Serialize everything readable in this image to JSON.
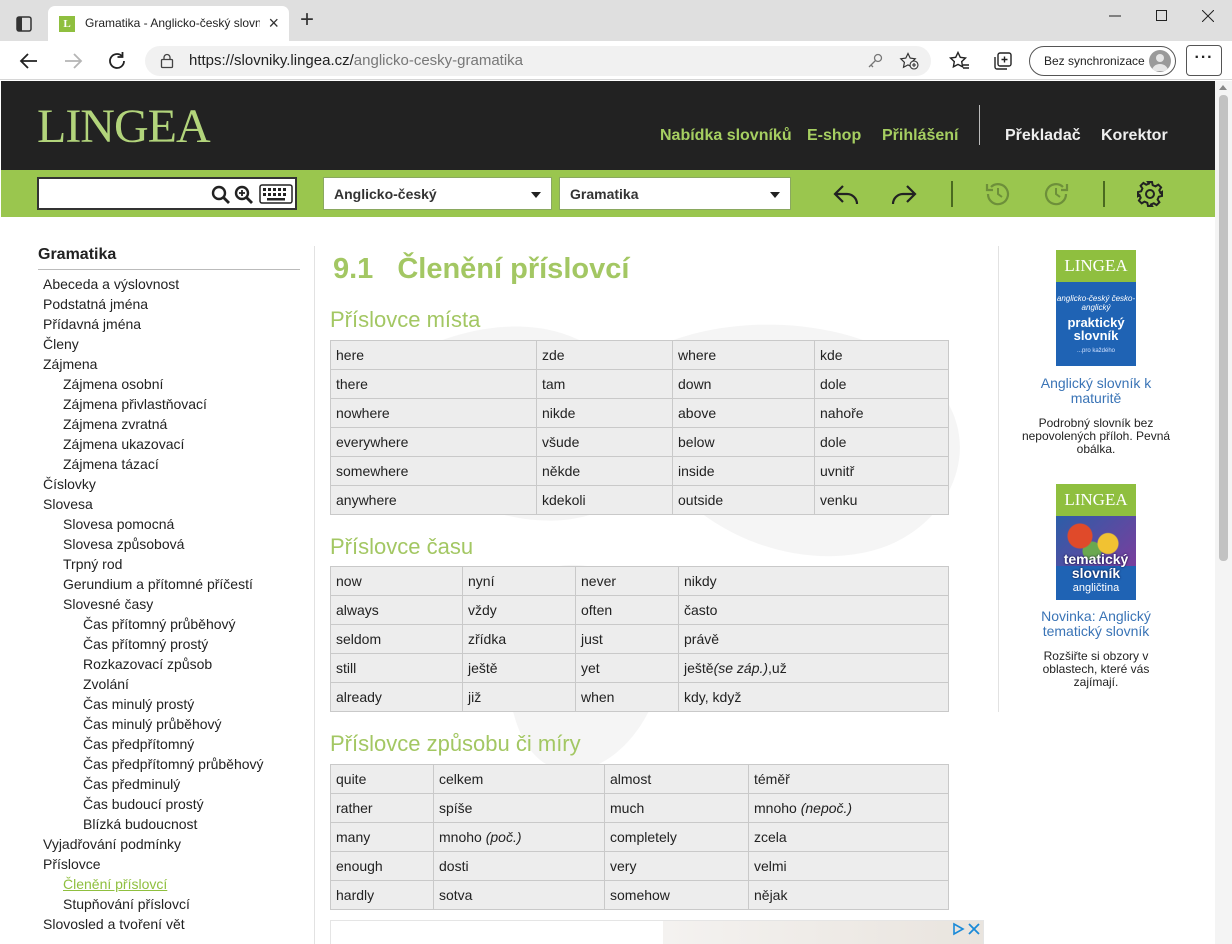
{
  "browser": {
    "tab_title": "Gramatika - Anglicko-český slovník",
    "tab_favicon": "L",
    "url_host": "https://slovniky.lingea.cz/",
    "url_path": "anglicko-cesky-gramatika",
    "sync_label": "Bez synchronizace",
    "more_label": "···"
  },
  "header": {
    "logo": "LINGEA",
    "nav_green": [
      "Nabídka slovníků",
      "E-shop",
      "Přihlášení"
    ],
    "nav_white": [
      "Překladač",
      "Korektor"
    ]
  },
  "toolbar": {
    "search_value": "",
    "dictionary_select": "Anglicko-český",
    "section_select": "Gramatika"
  },
  "sidebar": {
    "title": "Gramatika",
    "items": [
      {
        "label": "Abeceda a výslovnost",
        "level": 0
      },
      {
        "label": "Podstatná jména",
        "level": 0
      },
      {
        "label": "Přídavná jména",
        "level": 0
      },
      {
        "label": "Členy",
        "level": 0
      },
      {
        "label": "Zájmena",
        "level": 0
      },
      {
        "label": "Zájmena osobní",
        "level": 1
      },
      {
        "label": "Zájmena přivlastňovací",
        "level": 1
      },
      {
        "label": "Zájmena zvratná",
        "level": 1
      },
      {
        "label": "Zájmena ukazovací",
        "level": 1
      },
      {
        "label": "Zájmena tázací",
        "level": 1
      },
      {
        "label": "Číslovky",
        "level": 0
      },
      {
        "label": "Slovesa",
        "level": 0
      },
      {
        "label": "Slovesa pomocná",
        "level": 1
      },
      {
        "label": "Slovesa způsobová",
        "level": 1
      },
      {
        "label": "Trpný rod",
        "level": 1
      },
      {
        "label": "Gerundium a přítomné příčestí",
        "level": 1
      },
      {
        "label": "Slovesné časy",
        "level": 1
      },
      {
        "label": "Čas přítomný průběhový",
        "level": 2
      },
      {
        "label": "Čas přítomný prostý",
        "level": 2
      },
      {
        "label": "Rozkazovací způsob",
        "level": 2
      },
      {
        "label": "Zvolání",
        "level": 2
      },
      {
        "label": "Čas minulý prostý",
        "level": 2
      },
      {
        "label": "Čas minulý průběhový",
        "level": 2
      },
      {
        "label": "Čas předpřítomný",
        "level": 2
      },
      {
        "label": "Čas předpřítomný průběhový",
        "level": 2
      },
      {
        "label": "Čas předminulý",
        "level": 2
      },
      {
        "label": "Čas budoucí prostý",
        "level": 2
      },
      {
        "label": "Blízká budoucnost",
        "level": 2
      },
      {
        "label": "Vyjadřování podmínky",
        "level": 0
      },
      {
        "label": "Příslovce",
        "level": 0
      },
      {
        "label": "Členění příslovcí",
        "level": 1,
        "active": true
      },
      {
        "label": "Stupňování příslovcí",
        "level": 1
      },
      {
        "label": "Slovosled a tvoření vět",
        "level": 0
      }
    ]
  },
  "main": {
    "heading_number": "9.1",
    "heading_title": "Členění příslovcí",
    "sections": [
      {
        "title": "Příslovce místa",
        "rows": [
          [
            "here",
            "zde",
            "where",
            "kde"
          ],
          [
            "there",
            "tam",
            "down",
            "dole"
          ],
          [
            "nowhere",
            "nikde",
            "above",
            "nahoře"
          ],
          [
            "everywhere",
            "všude",
            "below",
            "dole"
          ],
          [
            "somewhere",
            "někde",
            "inside",
            "uvnitř"
          ],
          [
            "anywhere",
            "kdekoli",
            "outside",
            "venku"
          ]
        ]
      },
      {
        "title": "Příslovce času",
        "rows": [
          [
            "now",
            "nyní",
            "never",
            "nikdy"
          ],
          [
            "always",
            "vždy",
            "often",
            "často"
          ],
          [
            "seldom",
            "zřídka",
            "just",
            "právě"
          ],
          [
            "still",
            "ještě",
            "yet",
            "ještě|(se záp.)|,už"
          ],
          [
            "already",
            "již",
            "when",
            "kdy, když"
          ]
        ]
      },
      {
        "title": "Příslovce způsobu či míry",
        "rows": [
          [
            "quite",
            "celkem",
            "almost",
            "téměř"
          ],
          [
            "rather",
            "spíše",
            "much",
            "mnoho |(nepoč.)|"
          ],
          [
            "many",
            "mnoho |(poč.)|",
            "completely",
            "zcela"
          ],
          [
            "enough",
            "dosti",
            "very",
            "velmi"
          ],
          [
            "hardly",
            "sotva",
            "somehow",
            "nějak"
          ]
        ]
      }
    ]
  },
  "promos": [
    {
      "book_brand": "LINGEA",
      "book_sub": "anglicko-český česko-anglický",
      "book_title": "praktický slovník",
      "book_small": "...pro každého",
      "link": "Anglický slovník k maturitě",
      "text": "Podrobný slovník bez nepovolených příloh. Pevná obálka."
    },
    {
      "book_brand": "LINGEA",
      "book_title": "tematický slovník",
      "book_sub": "angličtina",
      "link": "Novinka: Anglický tematický slovník",
      "text": "Rozšiřte si obzory v oblastech, které vás zajímají."
    }
  ],
  "icons": {
    "tab_actions": "tab-actions-icon",
    "back": "back-arrow-icon",
    "forward": "forward-arrow-icon",
    "refresh": "refresh-icon",
    "lock": "lock-icon",
    "search": "search-icon",
    "zoom_plus": "zoom-plus-icon",
    "keyboard": "keyboard-icon",
    "settings": "gear-icon"
  },
  "colors": {
    "brand_green": "#9ac64e",
    "heading_green": "#a3c763",
    "header_dark": "#222222",
    "link_blue": "#3a74b6"
  }
}
